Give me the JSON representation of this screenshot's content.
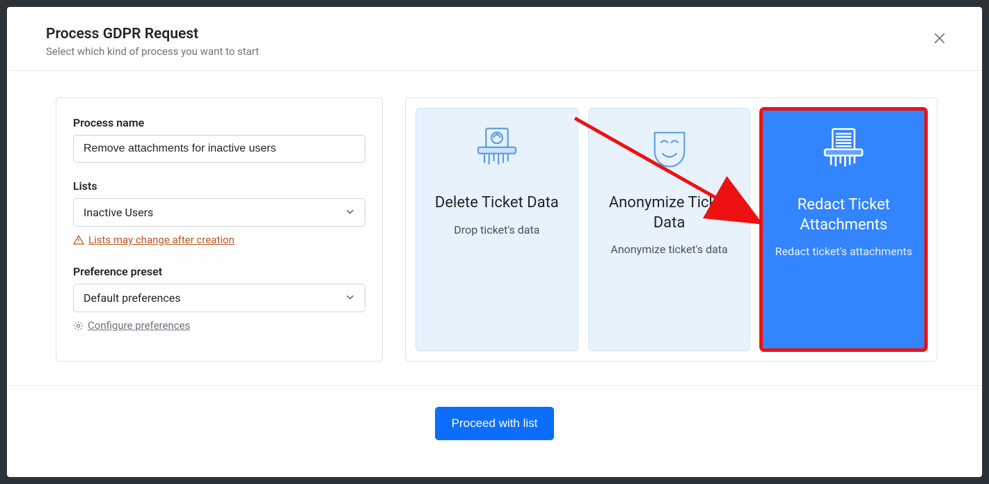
{
  "header": {
    "title": "Process GDPR Request",
    "subtitle": "Select which kind of process you want to start"
  },
  "form": {
    "processName": {
      "label": "Process name",
      "value": "Remove attachments for inactive users"
    },
    "lists": {
      "label": "Lists",
      "value": "Inactive Users",
      "warning": "Lists may change after creation"
    },
    "preset": {
      "label": "Preference preset",
      "value": "Default preferences",
      "configure": "Configure preferences"
    }
  },
  "cards": [
    {
      "title": "Delete Ticket Data",
      "desc": "Drop ticket's data",
      "selected": false,
      "icon": "shredder-head"
    },
    {
      "title": "Anonymize Ticket Data",
      "desc": "Anonymize ticket's data",
      "selected": false,
      "icon": "anon-mask"
    },
    {
      "title": "Redact Ticket Attachments",
      "desc": "Redact ticket's attachments",
      "selected": true,
      "icon": "shredder-doc"
    }
  ],
  "footer": {
    "proceed": "Proceed with list"
  }
}
